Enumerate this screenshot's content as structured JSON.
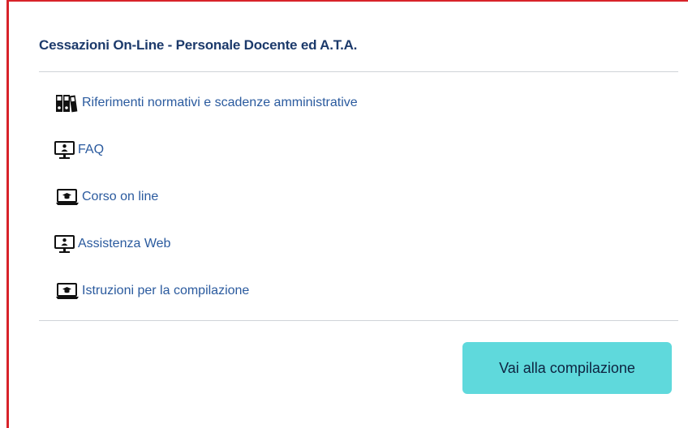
{
  "card": {
    "title": "Cessazioni On-Line - Personale Docente ed A.T.A.",
    "links": [
      {
        "label": "Riferimenti normativi e scadenze amministrative",
        "icon": "binders-icon"
      },
      {
        "label": "FAQ",
        "icon": "monitor-person-icon"
      },
      {
        "label": "Corso on line",
        "icon": "laptop-graduation-cap-icon"
      },
      {
        "label": "Assistenza Web",
        "icon": "monitor-person-icon"
      },
      {
        "label": "Istruzioni per la compilazione",
        "icon": "laptop-graduation-cap-icon"
      }
    ],
    "button_label": "Vai alla compilazione"
  },
  "colors": {
    "accent_border": "#d8232a",
    "title": "#1c3a6b",
    "link": "#2a5a9e",
    "button_bg": "#5fd9dc",
    "divider": "#cfd3d8"
  }
}
